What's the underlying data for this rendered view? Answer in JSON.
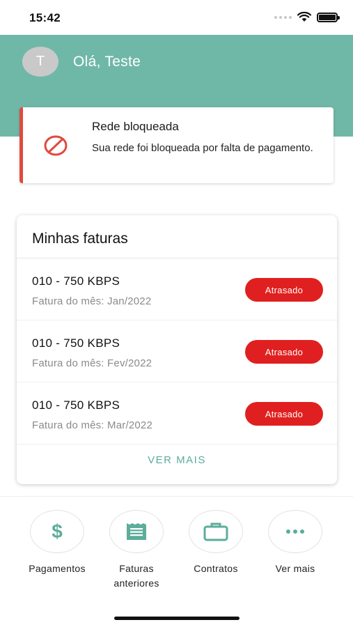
{
  "status_bar": {
    "time": "15:42"
  },
  "header": {
    "avatar_initial": "T",
    "greeting": "Olá, Teste"
  },
  "alert": {
    "title": "Rede bloqueada",
    "message": "Sua rede foi bloqueada por falta de pagamento.",
    "icon": "blocked-icon",
    "accent_color": "#e04a3f"
  },
  "invoices": {
    "title": "Minhas faturas",
    "items": [
      {
        "plan": "010 - 750 KBPS",
        "month": "Fatura do mês: Jan/2022",
        "status": "Atrasado"
      },
      {
        "plan": "010 - 750 KBPS",
        "month": "Fatura do mês: Fev/2022",
        "status": "Atrasado"
      },
      {
        "plan": "010 - 750 KBPS",
        "month": "Fatura do mês: Mar/2022",
        "status": "Atrasado"
      }
    ],
    "see_more": "VER MAIS"
  },
  "shortcuts": [
    {
      "label": "Pagamentos",
      "icon": "dollar-icon"
    },
    {
      "label": "Faturas anteriores",
      "icon": "receipt-icon"
    },
    {
      "label": "Contratos",
      "icon": "briefcase-icon"
    },
    {
      "label": "Ver mais",
      "icon": "more-dots-icon"
    }
  ],
  "colors": {
    "header_background": "#6fb8a8",
    "accent": "#5cad9b",
    "overdue_badge": "#e02020"
  }
}
